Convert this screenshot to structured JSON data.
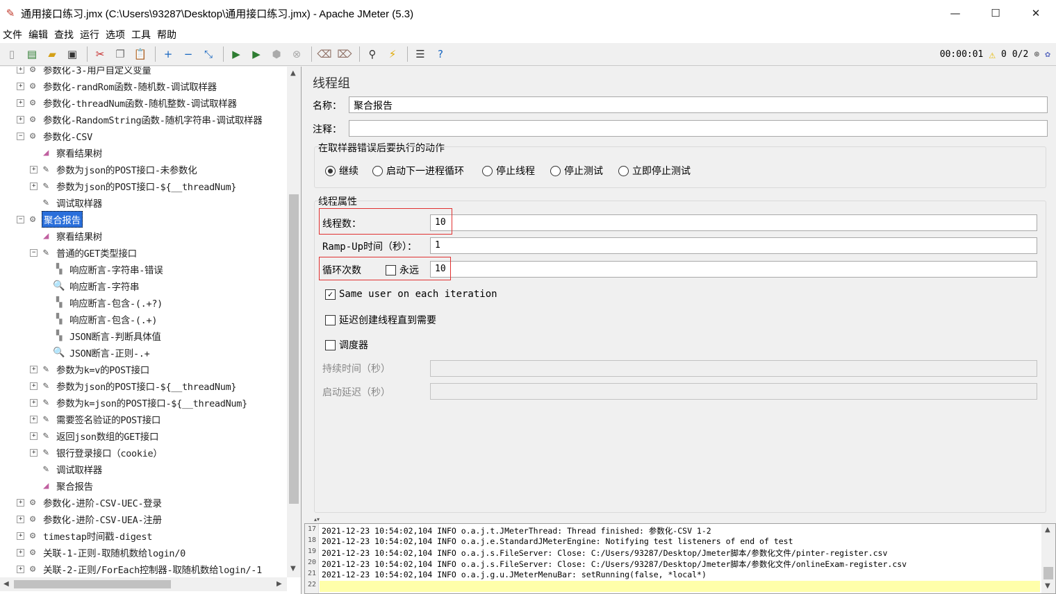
{
  "window": {
    "title": "通用接口练习.jmx (C:\\Users\\93287\\Desktop\\通用接口练习.jmx) - Apache JMeter (5.3)",
    "minimize": "—",
    "maximize": "☐",
    "close": "✕"
  },
  "menu": [
    "文件",
    "编辑",
    "查找",
    "运行",
    "选项",
    "工具",
    "帮助"
  ],
  "toolbar": {
    "timer": "00:00:01",
    "warnings": "0",
    "threads": "0/2"
  },
  "tree": {
    "nodes": [
      {
        "label": "参数化-3-用户自定义变量",
        "icon": "gear-icon",
        "level": 0,
        "exp": "+"
      },
      {
        "label": "参数化-randRom函数-随机数-调试取样器",
        "icon": "gear-icon",
        "level": 0,
        "exp": "+"
      },
      {
        "label": "参数化-threadNum函数-随机整数-调试取样器",
        "icon": "gear-icon",
        "level": 0,
        "exp": "+"
      },
      {
        "label": "参数化-RandomString函数-随机字符串-调试取样器",
        "icon": "gear-icon",
        "level": 0,
        "exp": "+"
      },
      {
        "label": "参数化-CSV",
        "icon": "gear-icon",
        "level": 0,
        "exp": "−"
      },
      {
        "label": "察看结果树",
        "icon": "chart-icon",
        "level": 1,
        "exp": ""
      },
      {
        "label": "参数为json的POST接口-未参数化",
        "icon": "pen-icon",
        "level": 1,
        "exp": "+"
      },
      {
        "label": "参数为json的POST接口-${__threadNum}",
        "icon": "pen-icon",
        "level": 1,
        "exp": "+"
      },
      {
        "label": "调试取样器",
        "icon": "pen-icon",
        "level": 1,
        "exp": ""
      },
      {
        "label": "聚合报告",
        "icon": "gear-icon",
        "level": 0,
        "exp": "−",
        "selected": true
      },
      {
        "label": "察看结果树",
        "icon": "chart-icon",
        "level": 1,
        "exp": ""
      },
      {
        "label": "普通的GET类型接口",
        "icon": "pen-icon",
        "level": 1,
        "exp": "−"
      },
      {
        "label": "响应断言-字符串-错误",
        "icon": "assert-icon",
        "level": 2,
        "exp": ""
      },
      {
        "label": "响应断言-字符串",
        "icon": "magnifier-icon",
        "level": 2,
        "exp": ""
      },
      {
        "label": "响应断言-包含-(.+?)",
        "icon": "assert-icon",
        "level": 2,
        "exp": ""
      },
      {
        "label": "响应断言-包含-(.+)",
        "icon": "assert-icon",
        "level": 2,
        "exp": ""
      },
      {
        "label": "JSON断言-判断具体值",
        "icon": "assert-icon",
        "level": 2,
        "exp": ""
      },
      {
        "label": "JSON断言-正则-.+",
        "icon": "magnifier-icon",
        "level": 2,
        "exp": ""
      },
      {
        "label": "参数为k=v的POST接口",
        "icon": "pen-icon",
        "level": 1,
        "exp": "+"
      },
      {
        "label": "参数为json的POST接口-${__threadNum}",
        "icon": "pen-icon",
        "level": 1,
        "exp": "+"
      },
      {
        "label": "参数为k=json的POST接口-${__threadNum}",
        "icon": "pen-icon",
        "level": 1,
        "exp": "+"
      },
      {
        "label": "需要签名验证的POST接口",
        "icon": "pen-icon",
        "level": 1,
        "exp": "+"
      },
      {
        "label": "返回json数组的GET接口",
        "icon": "pen-icon",
        "level": 1,
        "exp": "+"
      },
      {
        "label": "银行登录接口（cookie）",
        "icon": "pen-icon",
        "level": 1,
        "exp": "+"
      },
      {
        "label": "调试取样器",
        "icon": "pen-icon",
        "level": 1,
        "exp": ""
      },
      {
        "label": "聚合报告",
        "icon": "chart-icon",
        "level": 1,
        "exp": ""
      },
      {
        "label": "参数化-进阶-CSV-UEC-登录",
        "icon": "gear-icon",
        "level": 0,
        "exp": "+"
      },
      {
        "label": "参数化-进阶-CSV-UEA-注册",
        "icon": "gear-icon",
        "level": 0,
        "exp": "+"
      },
      {
        "label": "timestap时间戳-digest",
        "icon": "gear-icon",
        "level": 0,
        "exp": "+"
      },
      {
        "label": "关联-1-正则-取随机数给login/0",
        "icon": "gear-icon",
        "level": 0,
        "exp": "+"
      },
      {
        "label": "关联-2-正则/ForEach控制器-取随机数给login/-1",
        "icon": "gear-icon",
        "level": 0,
        "exp": "+"
      }
    ]
  },
  "panel": {
    "title": "线程组",
    "name_label": "名称：",
    "name_value": "聚合报告",
    "comment_label": "注释：",
    "comment_value": "",
    "error_action": {
      "title": "在取样器错误后要执行的动作",
      "options": [
        "继续",
        "启动下一进程循环",
        "停止线程",
        "停止测试",
        "立即停止测试"
      ],
      "selected": "继续"
    },
    "thread_props": {
      "title": "线程属性",
      "threads_label": "线程数：",
      "threads_value": "10",
      "rampup_label": "Ramp-Up时间（秒）：",
      "rampup_value": "1",
      "loop_label": "循环次数",
      "forever_label": "永远",
      "forever_checked": false,
      "loop_value": "10",
      "same_user_label": "Same user on each iteration",
      "same_user_checked": true,
      "delay_label": "延迟创建线程直到需要",
      "delay_checked": false,
      "scheduler_label": "调度器",
      "scheduler_checked": false,
      "duration_label": "持续时间（秒）",
      "duration_value": "",
      "startup_delay_label": "启动延迟（秒）",
      "startup_delay_value": ""
    }
  },
  "log": {
    "lines": [
      {
        "n": "17",
        "text": "2021-12-23 10:54:02,104 INFO o.a.j.t.JMeterThread: Thread finished: 参数化-CSV 1-2"
      },
      {
        "n": "18",
        "text": "2021-12-23 10:54:02,104 INFO o.a.j.e.StandardJMeterEngine: Notifying test listeners of end of test"
      },
      {
        "n": "19",
        "text": "2021-12-23 10:54:02,104 INFO o.a.j.s.FileServer: Close: C:/Users/93287/Desktop/Jmeter脚本/参数化文件/pinter-register.csv"
      },
      {
        "n": "20",
        "text": "2021-12-23 10:54:02,104 INFO o.a.j.s.FileServer: Close: C:/Users/93287/Desktop/Jmeter脚本/参数化文件/onlineExam-register.csv"
      },
      {
        "n": "21",
        "text": "2021-12-23 10:54:02,104 INFO o.a.j.g.u.JMeterMenuBar: setRunning(false, *local*)"
      },
      {
        "n": "22",
        "text": ""
      }
    ]
  },
  "colors": {
    "selection": "#2a6fdb",
    "highlight_box": "#e03030",
    "log_highlight": "#ffffaa"
  }
}
